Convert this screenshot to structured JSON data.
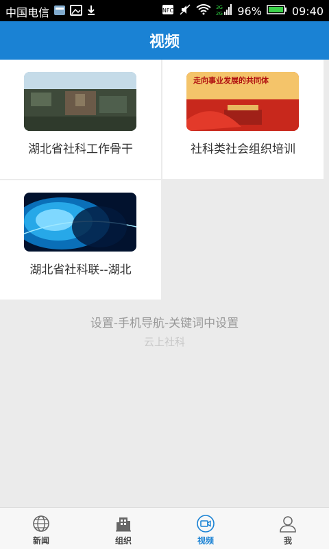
{
  "status_bar": {
    "carrier": "中国电信",
    "battery": "96%",
    "time": "09:40",
    "network": "3G"
  },
  "header": {
    "title": "视频"
  },
  "videos": [
    {
      "title": "湖北省社科工作骨干",
      "thumb": "city-aerial"
    },
    {
      "title": "社科类社会组织培训",
      "thumb": "red-banner",
      "thumb_text": "走向事业发展的共同体"
    },
    {
      "title": "湖北省社科联--湖北",
      "thumb": "blue-globe"
    }
  ],
  "footer": {
    "hint": "设置-手机导航-关键词中设置",
    "brand": "云上社科"
  },
  "tabs": [
    {
      "label": "新闻",
      "icon": "globe-icon",
      "active": false
    },
    {
      "label": "组织",
      "icon": "building-icon",
      "active": false
    },
    {
      "label": "视频",
      "icon": "video-icon",
      "active": true
    },
    {
      "label": "我",
      "icon": "user-icon",
      "active": false
    }
  ],
  "colors": {
    "accent": "#1a82d4",
    "background": "#ebebeb"
  }
}
